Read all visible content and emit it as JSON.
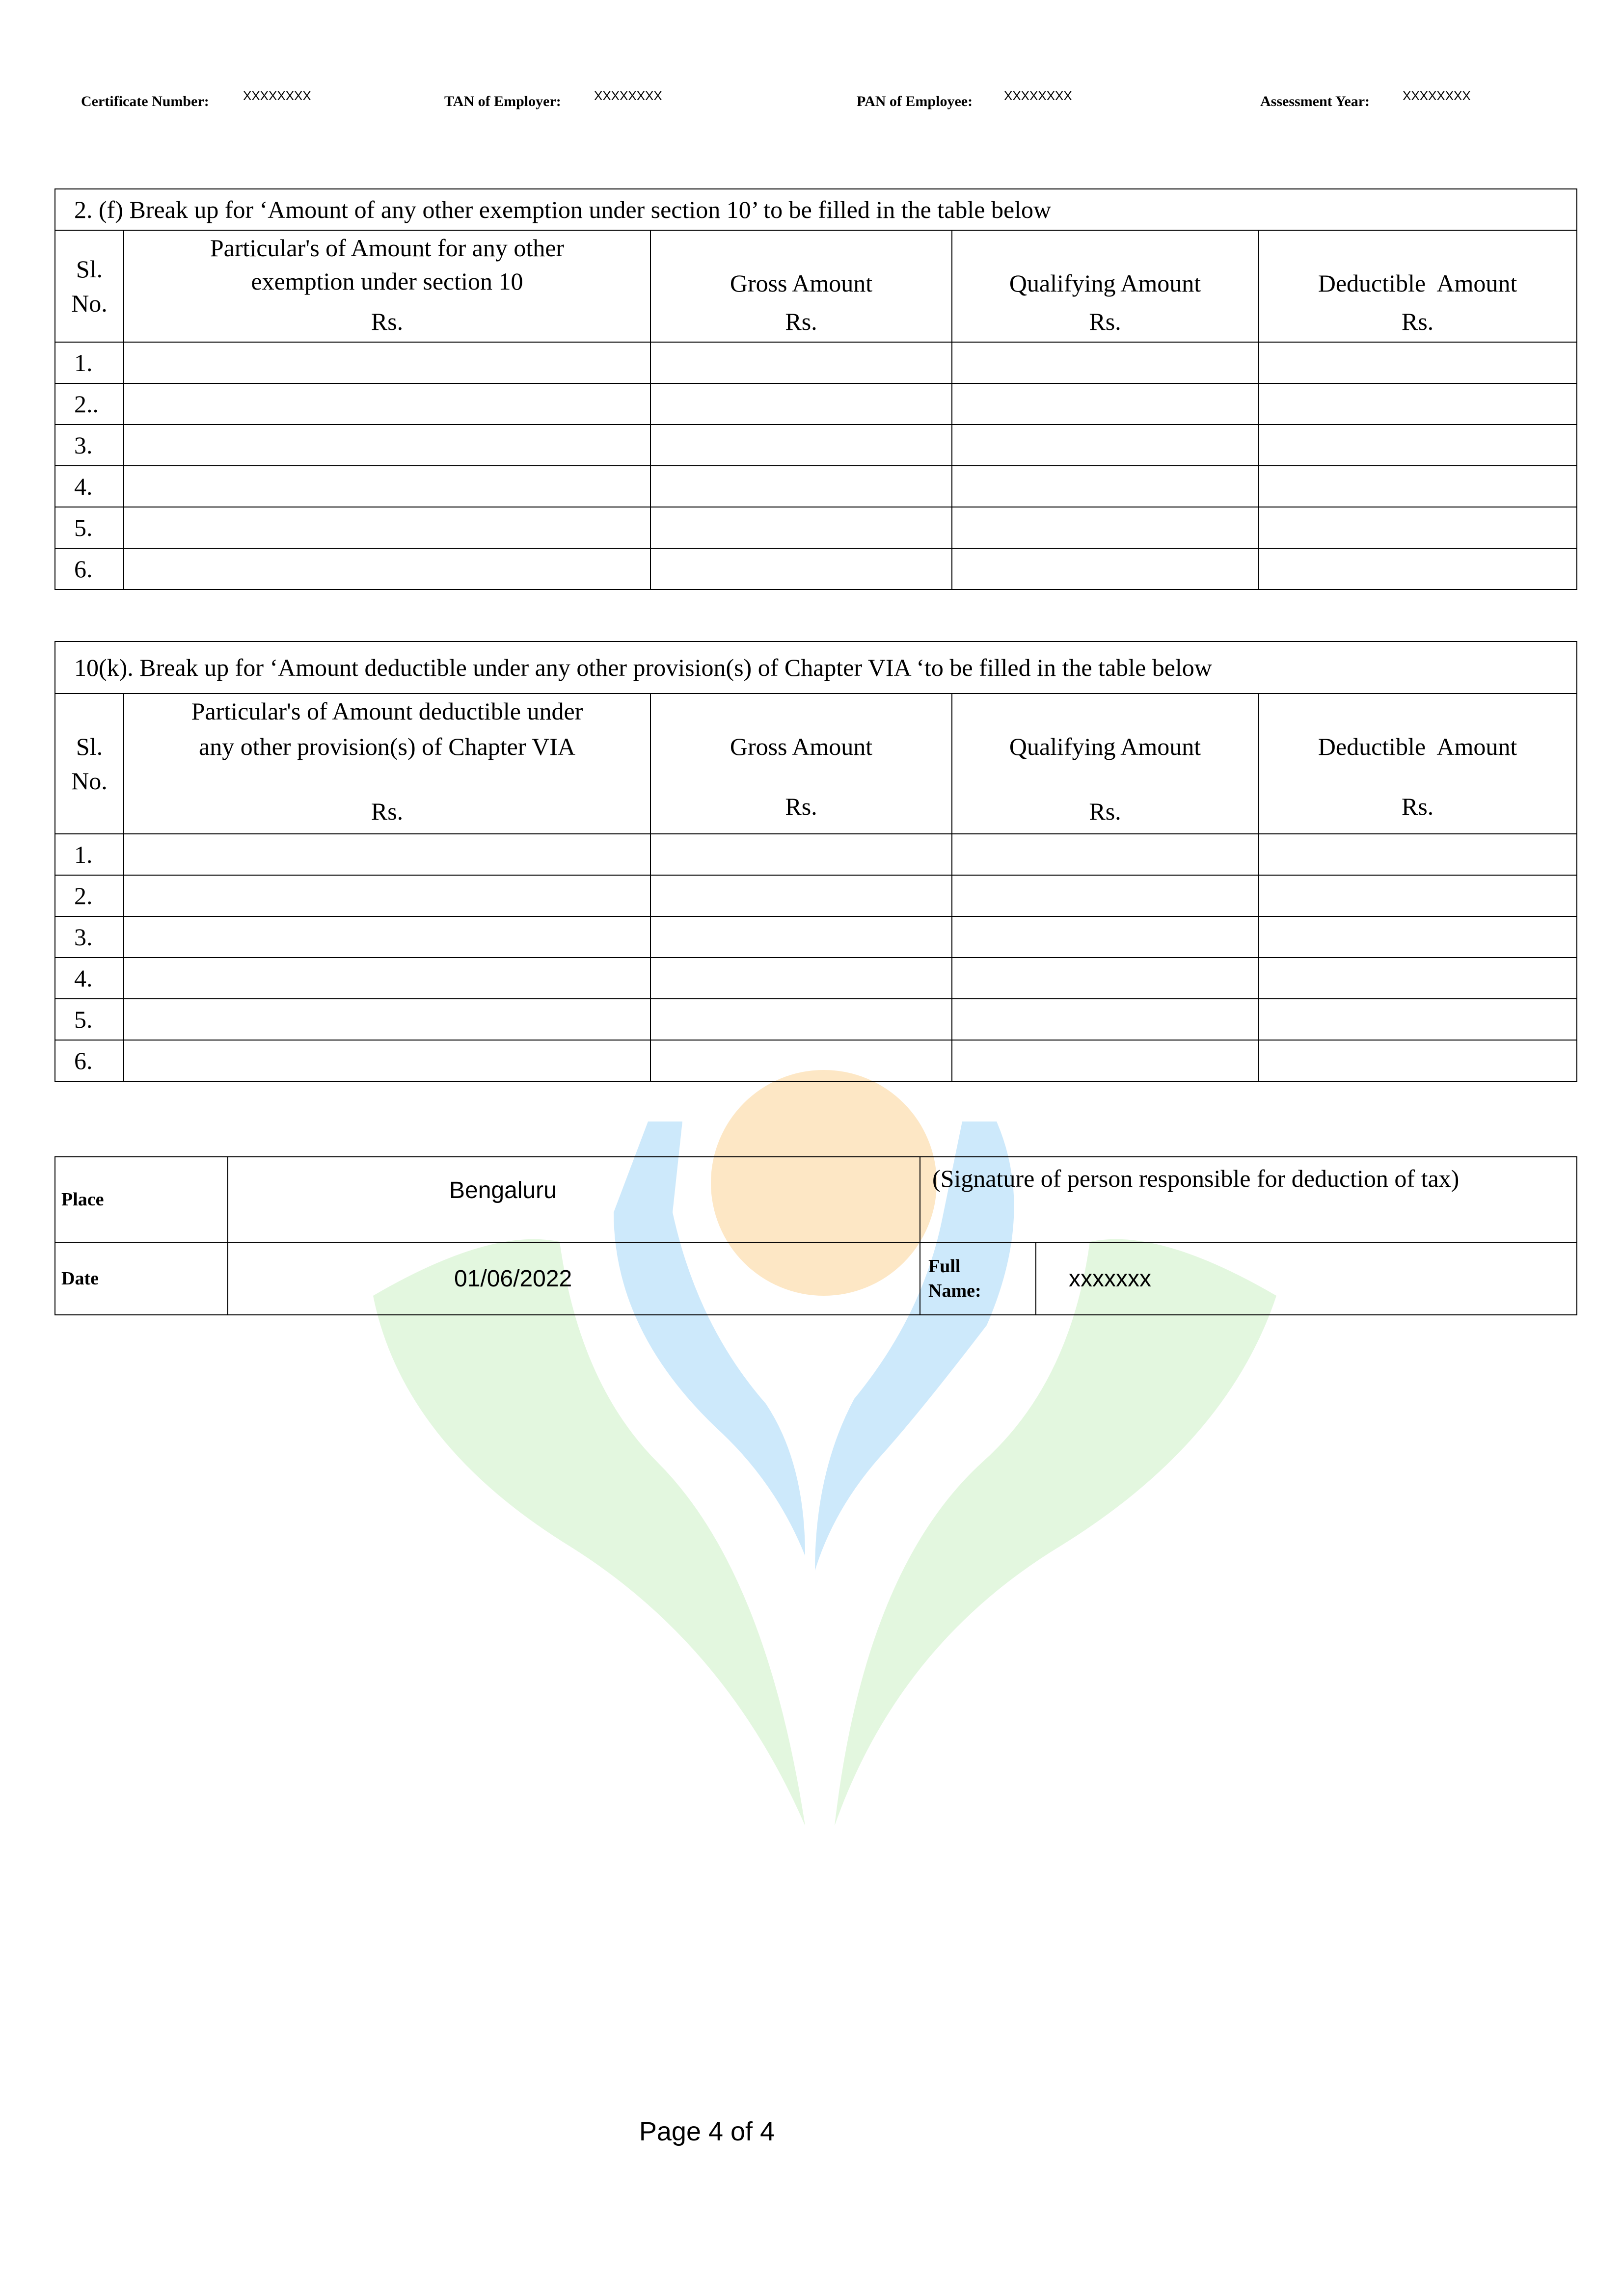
{
  "header": {
    "certificate_label": "Certificate Number:",
    "certificate_value": "XXXXXXXX",
    "tan_label": "TAN of Employer:",
    "tan_value": "XXXXXXXX",
    "pan_label": "PAN of Employee:",
    "pan_value": "XXXXXXXX",
    "ay_label": "Assessment Year:",
    "ay_value": "XXXXXXXX"
  },
  "table1": {
    "title": "2. (f) Break up for ‘Amount of any other exemption under section 10’ to be filled in the table below",
    "col_sl": "Sl.\nNo.",
    "col_particulars_1": "Particular's of Amount for any other",
    "col_particulars_2": "exemption under section 10",
    "col_gross": "Gross Amount",
    "col_qualifying": "Qualifying Amount",
    "col_deductible": "Deductible  Amount",
    "currency": "Rs.",
    "rows": [
      "1.",
      "2..",
      "3.",
      "4.",
      "5.",
      "6."
    ]
  },
  "table2": {
    "title": "10(k). Break up for ‘Amount deductible under any other provision(s) of Chapter VIA ‘to be filled in the table below",
    "col_sl": "Sl.\nNo.",
    "col_particulars_1": "Particular's of Amount deductible under",
    "col_particulars_2": "any other provision(s) of Chapter VIA",
    "col_gross": "Gross Amount",
    "col_qualifying": "Qualifying Amount",
    "col_deductible": "Deductible  Amount",
    "currency": "Rs.",
    "rows": [
      "1.",
      "2.",
      "3.",
      "4.",
      "5.",
      "6."
    ]
  },
  "signature": {
    "place_label": "Place",
    "place_value": "Bengaluru",
    "signature_text": "(Signature of person responsible for deduction of tax)",
    "date_label": "Date",
    "date_value": "01/06/2022",
    "full_name_label": "Full Name:",
    "full_name_value": "xxxxxxx"
  },
  "footer": {
    "page_text": "Page 4 of 4"
  }
}
